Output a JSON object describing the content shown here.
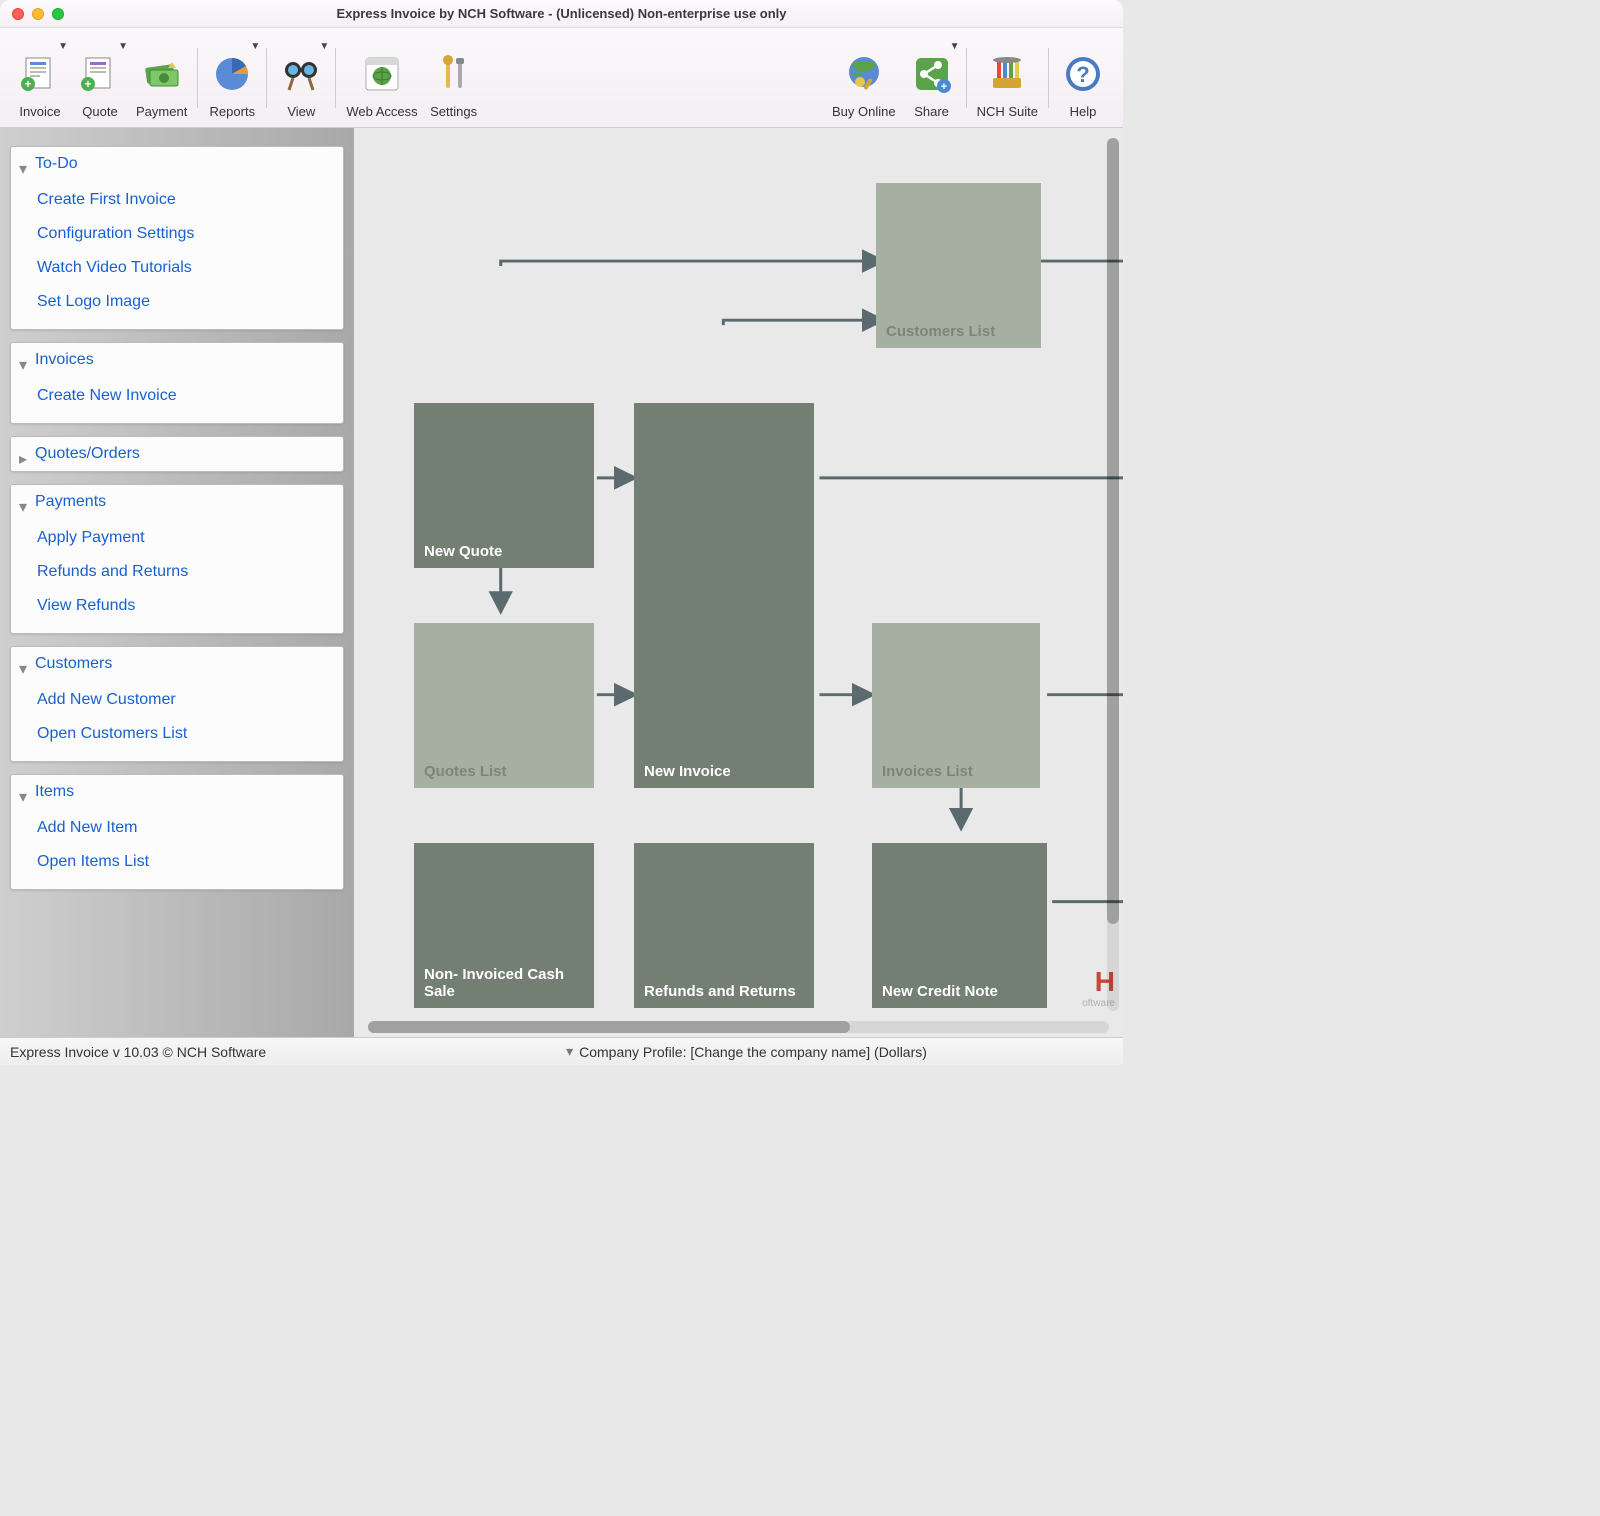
{
  "window": {
    "title": "Express Invoice by NCH Software - (Unlicensed) Non-enterprise use only"
  },
  "toolbar": [
    {
      "id": "invoice",
      "label": "Invoice",
      "dropdown": true
    },
    {
      "id": "quote",
      "label": "Quote",
      "dropdown": true
    },
    {
      "id": "payment",
      "label": "Payment"
    },
    {
      "id": "sep"
    },
    {
      "id": "reports",
      "label": "Reports",
      "dropdown": true
    },
    {
      "id": "sep"
    },
    {
      "id": "view",
      "label": "View",
      "dropdown": true
    },
    {
      "id": "sep"
    },
    {
      "id": "webaccess",
      "label": "Web Access"
    },
    {
      "id": "settings",
      "label": "Settings"
    },
    {
      "id": "spacer"
    },
    {
      "id": "buyonline",
      "label": "Buy Online"
    },
    {
      "id": "share",
      "label": "Share",
      "dropdown": true
    },
    {
      "id": "sep"
    },
    {
      "id": "nchsuite",
      "label": "NCH Suite"
    },
    {
      "id": "sep"
    },
    {
      "id": "help",
      "label": "Help"
    }
  ],
  "sidebar": [
    {
      "title": "To-Do",
      "open": true,
      "items": [
        "Create First Invoice",
        "Configuration Settings",
        "Watch Video Tutorials",
        "Set Logo Image"
      ]
    },
    {
      "title": "Invoices",
      "open": true,
      "items": [
        "Create New Invoice"
      ]
    },
    {
      "title": "Quotes/Orders",
      "open": false,
      "items": []
    },
    {
      "title": "Payments",
      "open": true,
      "items": [
        "Apply Payment",
        "Refunds and Returns",
        "View Refunds"
      ]
    },
    {
      "title": "Customers",
      "open": true,
      "items": [
        "Add New Customer",
        "Open Customers List"
      ]
    },
    {
      "title": "Items",
      "open": true,
      "items": [
        "Add New Item",
        "Open Items List"
      ]
    }
  ],
  "flow": {
    "customers_list": "Customers List",
    "new_quote": "New Quote",
    "quotes_list": "Quotes List",
    "new_invoice": "New Invoice",
    "invoices_list": "Invoices List",
    "cash_sale": "Non- Invoiced Cash Sale",
    "refunds": "Refunds and Returns",
    "credit_note": "New Credit Note"
  },
  "status": {
    "left": "Express Invoice v 10.03 © NCH Software",
    "center": "Company Profile: [Change the company name] (Dollars)"
  },
  "corner_brand": "oftware"
}
